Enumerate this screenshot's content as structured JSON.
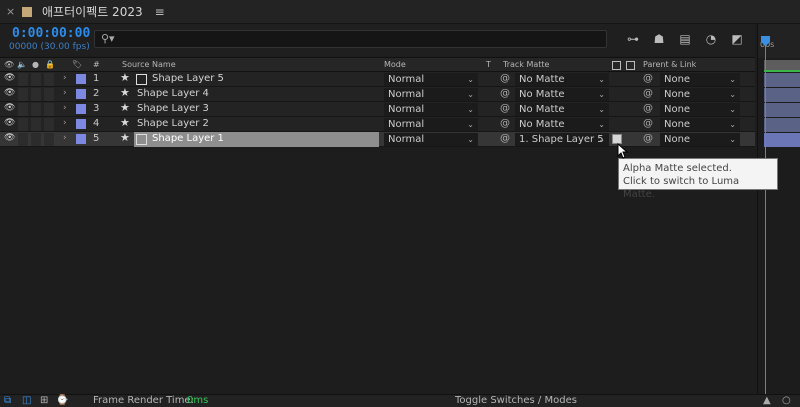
{
  "window": {
    "title": "애프터이펙트 2023",
    "close_glyph": "×",
    "menu_glyph": "≡"
  },
  "time": {
    "timecode": "0:00:00:00",
    "fps": "00000 (30.00 fps)"
  },
  "search": {
    "placeholder": ""
  },
  "columns": {
    "source_name": "Source Name",
    "mode": "Mode",
    "t": "T",
    "track_matte": "Track Matte",
    "parent_link": "Parent & Link",
    "hash": "#"
  },
  "layers": [
    {
      "num": "1",
      "name": "Shape Layer 5",
      "mode": "Normal",
      "matte": "No Matte",
      "parent": "None",
      "selected": false
    },
    {
      "num": "2",
      "name": "Shape Layer 4",
      "mode": "Normal",
      "matte": "No Matte",
      "parent": "None",
      "selected": false
    },
    {
      "num": "3",
      "name": "Shape Layer 3",
      "mode": "Normal",
      "matte": "No Matte",
      "parent": "None",
      "selected": false
    },
    {
      "num": "4",
      "name": "Shape Layer 2",
      "mode": "Normal",
      "matte": "No Matte",
      "parent": "None",
      "selected": false
    },
    {
      "num": "5",
      "name": "Shape Layer 1",
      "mode": "Normal",
      "matte": "1. Shape Layer 5",
      "parent": "None",
      "selected": true
    }
  ],
  "timeline": {
    "ruler_label": "00s"
  },
  "tooltip": {
    "line1": "Alpha Matte selected.",
    "line2": "Click to switch to Luma Matte."
  },
  "footer": {
    "render_label": "Frame Render Time:",
    "render_value": "0ms",
    "toggle": "Toggle Switches / Modes"
  },
  "colors": {
    "accent": "#2d8ceb",
    "label": "#7d88e0",
    "render_value": "#36c85a"
  }
}
